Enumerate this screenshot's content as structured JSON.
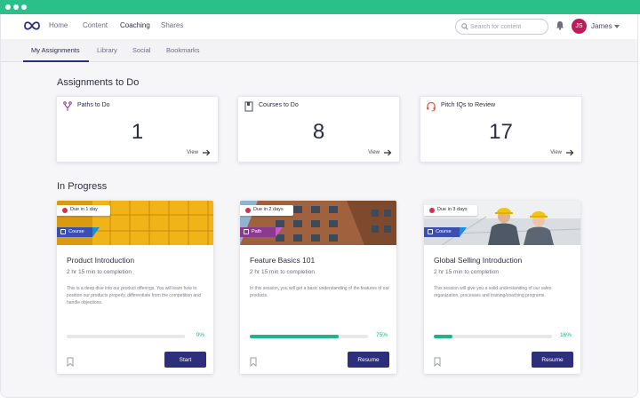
{
  "top_nav": {
    "links": [
      "Home",
      "Content",
      "Coaching",
      "Shares"
    ],
    "active": "Coaching",
    "search_placeholder": "Search for content",
    "user_initials": "JS",
    "user_name": "James"
  },
  "sub_nav": {
    "tabs": [
      "My Assignments",
      "Library",
      "Social",
      "Bookmarks"
    ],
    "active": "My Assignments"
  },
  "assignments": {
    "title": "Assignments to Do",
    "cards": [
      {
        "label": "Paths to Do",
        "count": "1",
        "view": "View",
        "icon": "path-icon"
      },
      {
        "label": "Courses to Do",
        "count": "8",
        "view": "View",
        "icon": "course-book-icon"
      },
      {
        "label": "Pitch IQs to Review",
        "count": "17",
        "view": "View",
        "icon": "headset-icon"
      }
    ]
  },
  "in_progress": {
    "title": "In Progress",
    "cards": [
      {
        "due": "Due in 1 day",
        "type": "Course",
        "title": "Product Introduction",
        "duration": "2 hr 15 min to completion",
        "description": "This is a deep dive into our product offerings. You will learn how to position our products properly, differentiate from the competition and handle objections.",
        "progress": 0,
        "progress_label": "0%",
        "action": "Start",
        "image": "yellow-building-facade"
      },
      {
        "due": "Due in 2 days",
        "type": "Path",
        "title": "Feature Basics 101",
        "duration": "2 hr 15 min to completion",
        "description": "In this session, you will get a basic understanding of the features of our products.",
        "progress": 75,
        "progress_label": "75%",
        "action": "Resume",
        "image": "brick-apartment-building"
      },
      {
        "due": "Due in 3 days",
        "type": "Course",
        "title": "Global Selling Introduction",
        "duration": "2 hr 15 min to completion",
        "description": "This session will give you a solid understanding of our sales organization, processes and training/coaching programs.",
        "progress": 16,
        "progress_label": "16%",
        "action": "Resume",
        "image": "engineers-in-hard-hats"
      }
    ]
  },
  "colors": {
    "titlebar": "#2bbf8a",
    "primary": "#2d2f7c",
    "progress": "#1fb58a",
    "due_dot": "#d6304f",
    "course_badge": "#3a4fb0",
    "path_badge": "#8a3a8f",
    "avatar": "#c2185b"
  }
}
